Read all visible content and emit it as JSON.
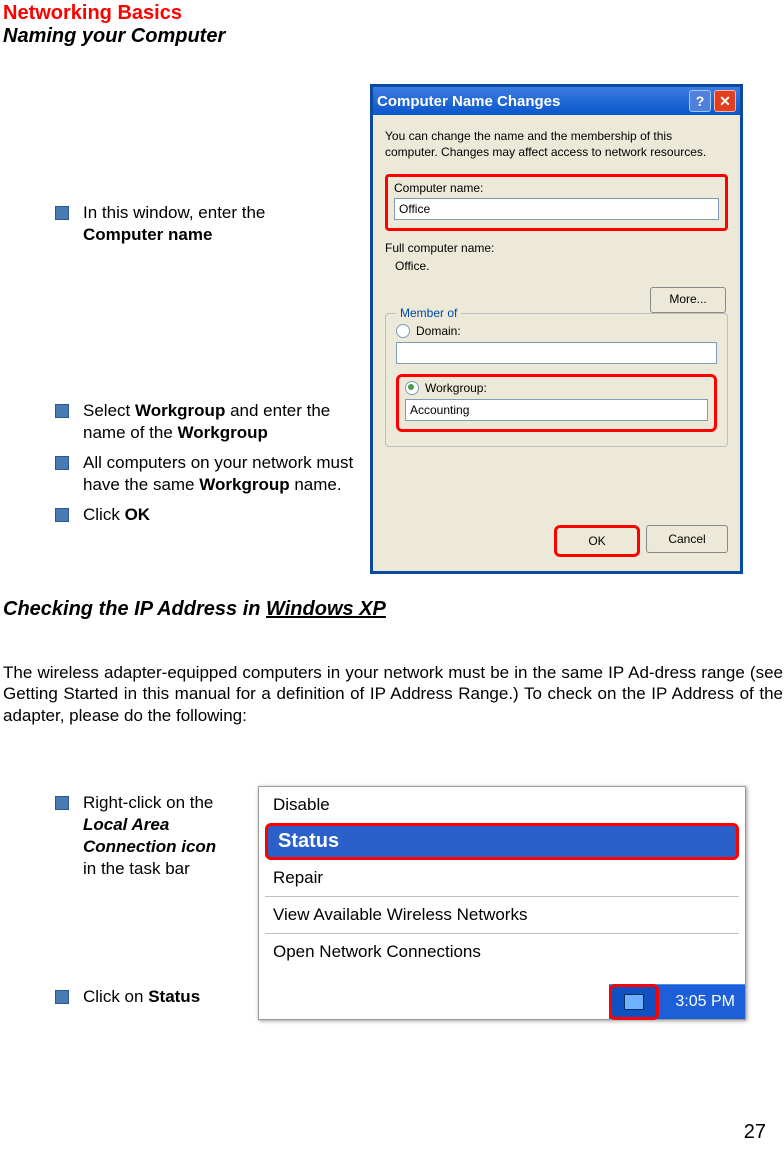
{
  "header": {
    "title": "Networking Basics",
    "subtitle": "Naming your Computer"
  },
  "instructions1": {
    "i1a": "In this window, enter the",
    "i1b": "Computer name",
    "i2a": "Select ",
    "i2b": "Workgroup",
    "i2c": " and enter the name of the ",
    "i2d": "Workgroup",
    "i3a": "All computers on your network must have the same ",
    "i3b": "Workgroup",
    "i3c": " name.",
    "i4a": "Click ",
    "i4b": "OK"
  },
  "dialog": {
    "title": "Computer Name Changes",
    "desc": "You can change the name and the membership of this computer. Changes may affect access to network resources.",
    "comp_label": "Computer name:",
    "comp_value": "Office",
    "full_label": "Full computer name:",
    "full_value": "Office.",
    "more_btn": "More...",
    "group_title": "Member of",
    "domain_label": "Domain:",
    "workgroup_label": "Workgroup:",
    "workgroup_value": "Accounting",
    "ok": "OK",
    "cancel": "Cancel"
  },
  "section2": {
    "title_a": "Checking the IP Address in ",
    "title_b": "Windows XP",
    "para": "The wireless adapter-equipped computers in your network must be in the same IP Ad-dress range (see Getting Started in this manual for a definition of IP Address Range.)  To check on the IP Address of the adapter, please do the following:",
    "i1a": "Right-click on the",
    "i1b": "Local Area Connection icon",
    "i1c": "in the task bar",
    "i2a": "Click on ",
    "i2b": "Status"
  },
  "menu": {
    "disable": "Disable",
    "status": "Status",
    "repair": "Repair",
    "view": "View Available Wireless Networks",
    "open": "Open Network Connections"
  },
  "tray": {
    "time": "3:05 PM"
  },
  "page": "27"
}
